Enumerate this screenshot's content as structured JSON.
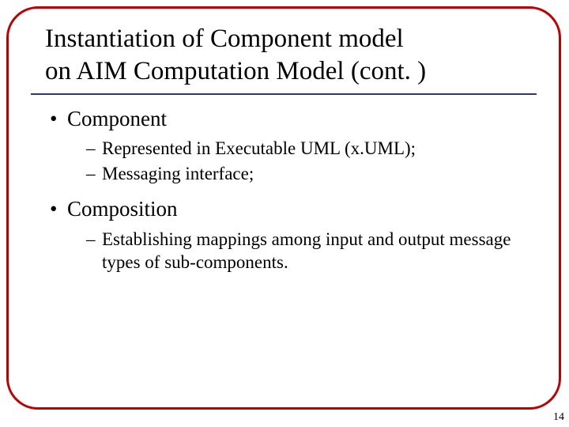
{
  "title_line1": "Instantiation of Component model",
  "title_line2": "on AIM Computation Model (cont. )",
  "bullets": {
    "b1": "Component",
    "b1_1": "Represented in Executable UML (x.UML);",
    "b1_2": "Messaging interface;",
    "b2": "Composition",
    "b2_1": "Establishing mappings among input and output message types of sub-components."
  },
  "page_number": "14"
}
